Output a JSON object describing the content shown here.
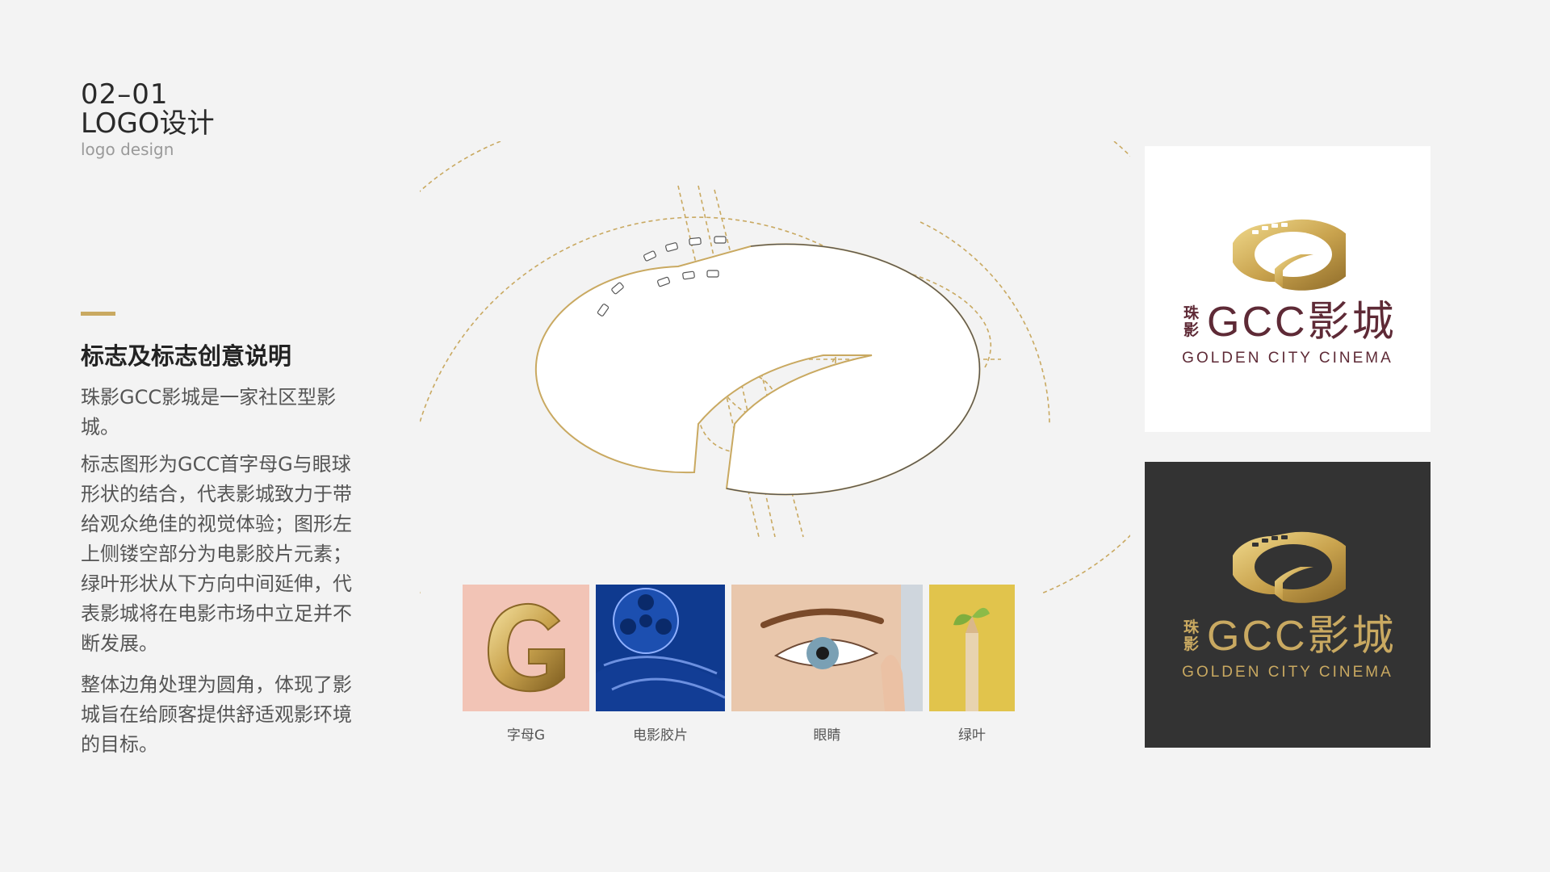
{
  "header": {
    "section_number": "02–01",
    "section_title": "LOGO设计",
    "section_subtitle": "logo design"
  },
  "description": {
    "heading": "标志及标志创意说明",
    "paragraphs": [
      "珠影GCC影城是一家社区型影城。",
      "标志图形为GCC首字母G与眼球形状的结合，代表影城致力于带给观众绝佳的视觉体验；图形左上侧镂空部分为电影胶片元素；绿叶形状从下方向中间延伸，代表影城将在电影市场中立足并不断发展。",
      "整体边角处理为圆角，体现了影城旨在给顾客提供舒适观影环境的目标。"
    ]
  },
  "references": [
    {
      "caption": "字母G"
    },
    {
      "caption": "电影胶片"
    },
    {
      "caption": "眼睛"
    },
    {
      "caption": "绿叶"
    }
  ],
  "logo": {
    "small_chars": [
      "珠",
      "影"
    ],
    "main_text": "GCC影城",
    "english_text": "GOLDEN CITY CINEMA"
  },
  "colors": {
    "accent_gold": "#c9a961",
    "brand_maroon": "#5e2a36",
    "dark_card": "#333333",
    "background": "#f3f3f3"
  }
}
